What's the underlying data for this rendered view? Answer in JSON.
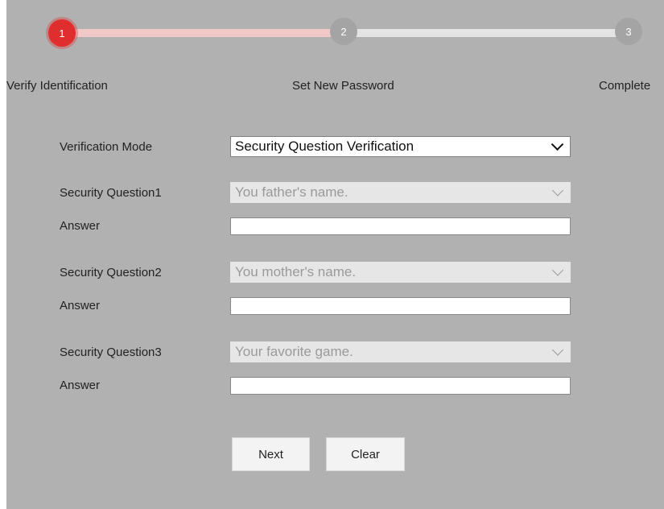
{
  "stepper": {
    "steps": [
      {
        "number": "1",
        "label": "Verify Identification",
        "state": "active"
      },
      {
        "number": "2",
        "label": "Set New Password",
        "state": "pending"
      },
      {
        "number": "3",
        "label": "Complete",
        "state": "pending"
      }
    ],
    "colors": {
      "active": "#e02e2e",
      "pending": "#a4a4a4",
      "track_done": "#f0c8c8",
      "track_todo": "#e4e4e4"
    }
  },
  "form": {
    "verification_mode": {
      "label": "Verification Mode",
      "value": "Security Question Verification"
    },
    "questions": [
      {
        "label": "Security Question1",
        "value": "You father's name.",
        "answer_label": "Answer",
        "answer_value": ""
      },
      {
        "label": "Security Question2",
        "value": "You mother's name.",
        "answer_label": "Answer",
        "answer_value": ""
      },
      {
        "label": "Security Question3",
        "value": "Your favorite game.",
        "answer_label": "Answer",
        "answer_value": ""
      }
    ]
  },
  "buttons": {
    "next": "Next",
    "clear": "Clear"
  },
  "icons": {
    "dropdown": "chevron-down-icon"
  }
}
